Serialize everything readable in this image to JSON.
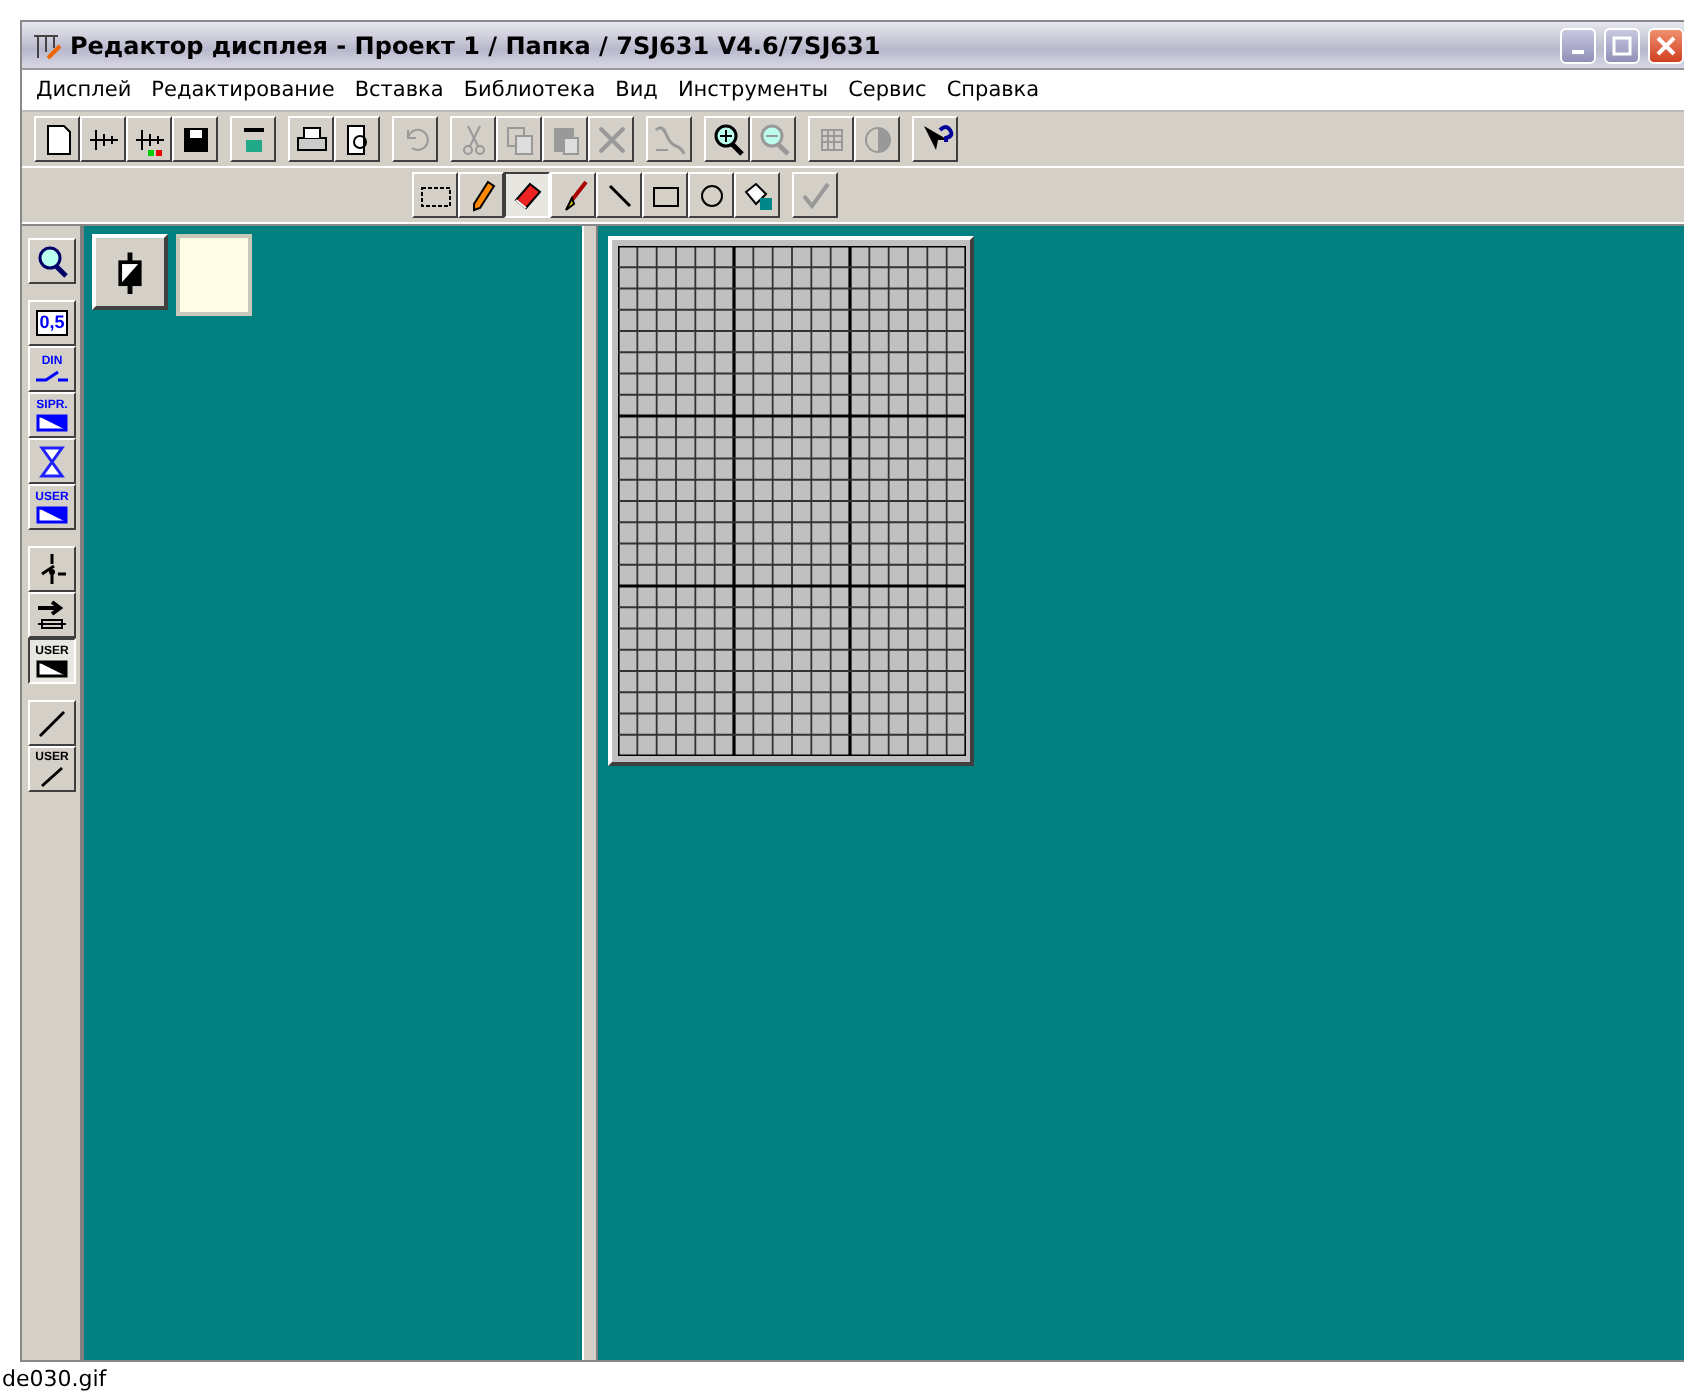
{
  "window": {
    "title": "Редактор дисплея - Проект 1 / Папка / 7SJ631 V4.6/7SJ631"
  },
  "menu": [
    "Дисплей",
    "Редактирование",
    "Вставка",
    "Библиотека",
    "Вид",
    "Инструменты",
    "Сервис",
    "Справка"
  ],
  "toolbar": {
    "groups": [
      [
        {
          "kind": "new",
          "disabled": false
        },
        {
          "kind": "plan",
          "disabled": false
        },
        {
          "kind": "plan-color",
          "disabled": false
        },
        {
          "kind": "save",
          "disabled": false
        }
      ],
      [
        {
          "kind": "spell",
          "disabled": false
        }
      ],
      [
        {
          "kind": "print",
          "disabled": false
        },
        {
          "kind": "preview",
          "disabled": false
        }
      ],
      [
        {
          "kind": "undo",
          "disabled": true
        }
      ],
      [
        {
          "kind": "cut",
          "disabled": true
        },
        {
          "kind": "copy",
          "disabled": true
        },
        {
          "kind": "paste",
          "disabled": true
        },
        {
          "kind": "delete",
          "disabled": true
        }
      ],
      [
        {
          "kind": "text",
          "disabled": true
        }
      ],
      [
        {
          "kind": "zoom-in",
          "disabled": false
        },
        {
          "kind": "zoom-out",
          "disabled": true
        }
      ],
      [
        {
          "kind": "grid",
          "disabled": true
        },
        {
          "kind": "contrast",
          "disabled": true
        }
      ],
      [
        {
          "kind": "help",
          "disabled": false
        }
      ]
    ]
  },
  "draw_toolbar": {
    "groups": [
      [
        {
          "kind": "select",
          "selected": false,
          "disabled": false
        },
        {
          "kind": "pencil",
          "selected": false,
          "disabled": false
        },
        {
          "kind": "eraser",
          "selected": true,
          "disabled": false
        },
        {
          "kind": "brush",
          "selected": false,
          "disabled": false
        },
        {
          "kind": "line",
          "selected": false,
          "disabled": false
        },
        {
          "kind": "rect",
          "selected": false,
          "disabled": false
        },
        {
          "kind": "circle",
          "selected": false,
          "disabled": false
        },
        {
          "kind": "fill",
          "selected": false,
          "disabled": false
        }
      ],
      [
        {
          "kind": "check",
          "selected": false,
          "disabled": true
        }
      ]
    ]
  },
  "library_tools": {
    "groups": [
      [
        {
          "kind": "magnifier",
          "selected": false
        }
      ],
      [
        {
          "kind": "value",
          "label": "0,5",
          "selected": false
        },
        {
          "kind": "labeled-switch",
          "label": "DIN",
          "selected": false
        },
        {
          "kind": "labeled-block",
          "label": "SIPR.",
          "selected": false
        },
        {
          "kind": "hourglass",
          "selected": false
        },
        {
          "kind": "labeled-block",
          "label": "USER",
          "selected": false
        }
      ],
      [
        {
          "kind": "switch",
          "selected": false
        },
        {
          "kind": "arrow",
          "selected": false
        },
        {
          "kind": "labeled-block-dark",
          "label": "USER",
          "selected": true
        }
      ],
      [
        {
          "kind": "slash",
          "selected": false
        },
        {
          "kind": "labeled-slash",
          "label": "USER",
          "selected": false
        }
      ]
    ]
  },
  "palette": [
    {
      "kind": "component"
    },
    {
      "kind": "swatch"
    }
  ],
  "caption": "de030.gif"
}
